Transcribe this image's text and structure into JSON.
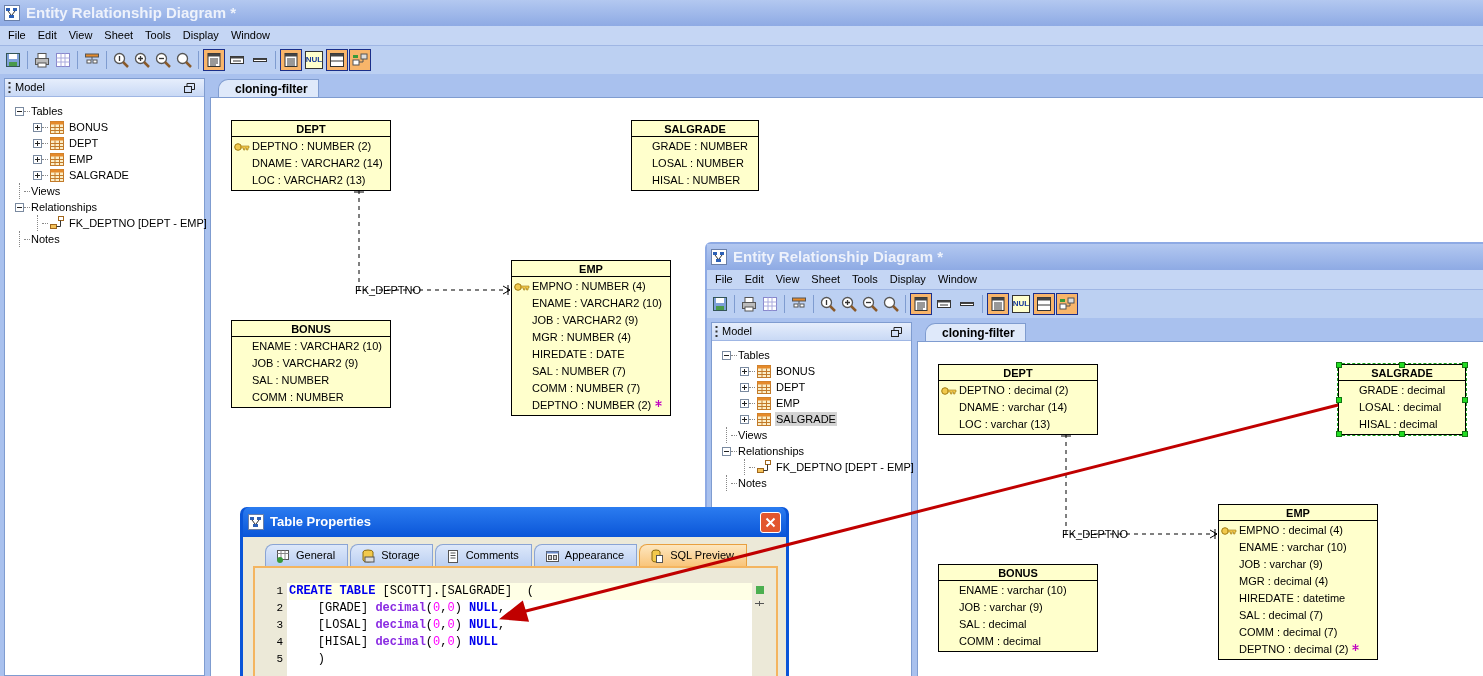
{
  "windows": [
    {
      "title": "Entity Relationship Diagram *",
      "menu": [
        "File",
        "Edit",
        "View",
        "Sheet",
        "Tools",
        "Display",
        "Window"
      ],
      "toolbar": {
        "view_toggles": [
          {
            "kind": "full",
            "selected": true
          },
          {
            "kind": "compact",
            "selected": false
          },
          {
            "kind": "title",
            "selected": false
          }
        ],
        "display_toggles": [
          {
            "kind": "columns",
            "selected": true
          },
          {
            "kind": "null",
            "label": "NUL",
            "selected": false
          },
          {
            "kind": "header",
            "selected": true
          },
          {
            "kind": "relation",
            "selected": true
          }
        ]
      },
      "model": {
        "title": "Model",
        "tree": [
          {
            "label": "Tables",
            "expanded": true,
            "children": [
              {
                "kind": "table",
                "label": "BONUS",
                "expanded": false,
                "selected": false
              },
              {
                "kind": "table",
                "label": "DEPT",
                "expanded": false,
                "selected": false
              },
              {
                "kind": "table",
                "label": "EMP",
                "expanded": false,
                "selected": false
              },
              {
                "kind": "table",
                "label": "SALGRADE",
                "expanded": false,
                "selected": false
              }
            ]
          },
          {
            "label": "Views"
          },
          {
            "label": "Relationships",
            "expanded": true,
            "children": [
              {
                "kind": "relationship",
                "label": "FK_DEPTNO [DEPT - EMP]",
                "selected": false
              }
            ]
          },
          {
            "label": "Notes"
          }
        ]
      },
      "tab": "cloning-filter",
      "diagram": {
        "entities": [
          {
            "name": "DEPT",
            "selected": false,
            "columns": [
              {
                "text": "DEPTNO : NUMBER (2)",
                "key": true,
                "fk": false
              },
              {
                "text": "DNAME : VARCHAR2 (14)",
                "key": false,
                "fk": false
              },
              {
                "text": "LOC : VARCHAR2 (13)",
                "key": false,
                "fk": false
              }
            ]
          },
          {
            "name": "SALGRADE",
            "selected": false,
            "columns": [
              {
                "text": "GRADE : NUMBER",
                "key": false,
                "fk": false
              },
              {
                "text": "LOSAL : NUMBER",
                "key": false,
                "fk": false
              },
              {
                "text": "HISAL : NUMBER",
                "key": false,
                "fk": false
              }
            ]
          },
          {
            "name": "EMP",
            "selected": false,
            "columns": [
              {
                "text": "EMPNO : NUMBER (4)",
                "key": true,
                "fk": false
              },
              {
                "text": "ENAME : VARCHAR2 (10)",
                "key": false,
                "fk": false
              },
              {
                "text": "JOB : VARCHAR2 (9)",
                "key": false,
                "fk": false
              },
              {
                "text": "MGR : NUMBER (4)",
                "key": false,
                "fk": false
              },
              {
                "text": "HIREDATE : DATE",
                "key": false,
                "fk": false
              },
              {
                "text": "SAL : NUMBER (7)",
                "key": false,
                "fk": false
              },
              {
                "text": "COMM : NUMBER (7)",
                "key": false,
                "fk": false
              },
              {
                "text": "DEPTNO : NUMBER (2)",
                "key": false,
                "fk": true
              }
            ]
          },
          {
            "name": "BONUS",
            "selected": false,
            "columns": [
              {
                "text": "ENAME : VARCHAR2 (10)",
                "key": false,
                "fk": false
              },
              {
                "text": "JOB : VARCHAR2 (9)",
                "key": false,
                "fk": false
              },
              {
                "text": "SAL : NUMBER",
                "key": false,
                "fk": false
              },
              {
                "text": "COMM : NUMBER",
                "key": false,
                "fk": false
              }
            ]
          }
        ],
        "relationships": [
          {
            "label": "FK_DEPTNO"
          }
        ]
      }
    },
    {
      "title": "Entity Relationship Diagram *",
      "menu": [
        "File",
        "Edit",
        "View",
        "Sheet",
        "Tools",
        "Display",
        "Window"
      ],
      "toolbar": {
        "view_toggles": [
          {
            "kind": "full",
            "selected": true
          },
          {
            "kind": "compact",
            "selected": false
          },
          {
            "kind": "title",
            "selected": false
          }
        ],
        "display_toggles": [
          {
            "kind": "columns",
            "selected": true
          },
          {
            "kind": "null",
            "label": "NUL",
            "selected": false
          },
          {
            "kind": "header",
            "selected": true
          },
          {
            "kind": "relation",
            "selected": true
          }
        ]
      },
      "model": {
        "title": "Model",
        "tree": [
          {
            "label": "Tables",
            "expanded": true,
            "children": [
              {
                "kind": "table",
                "label": "BONUS",
                "expanded": false,
                "selected": false
              },
              {
                "kind": "table",
                "label": "DEPT",
                "expanded": false,
                "selected": false
              },
              {
                "kind": "table",
                "label": "EMP",
                "expanded": false,
                "selected": false
              },
              {
                "kind": "table",
                "label": "SALGRADE",
                "expanded": false,
                "selected": true
              }
            ]
          },
          {
            "label": "Views"
          },
          {
            "label": "Relationships",
            "expanded": true,
            "children": [
              {
                "kind": "relationship",
                "label": "FK_DEPTNO [DEPT - EMP]",
                "selected": false
              }
            ]
          },
          {
            "label": "Notes"
          }
        ]
      },
      "tab": "cloning-filter",
      "diagram": {
        "entities": [
          {
            "name": "DEPT",
            "selected": false,
            "columns": [
              {
                "text": "DEPTNO : decimal (2)",
                "key": true,
                "fk": false
              },
              {
                "text": "DNAME : varchar (14)",
                "key": false,
                "fk": false
              },
              {
                "text": "LOC : varchar (13)",
                "key": false,
                "fk": false
              }
            ]
          },
          {
            "name": "SALGRADE",
            "selected": true,
            "columns": [
              {
                "text": "GRADE : decimal",
                "key": false,
                "fk": false
              },
              {
                "text": "LOSAL : decimal",
                "key": false,
                "fk": false
              },
              {
                "text": "HISAL : decimal",
                "key": false,
                "fk": false
              }
            ]
          },
          {
            "name": "EMP",
            "selected": false,
            "columns": [
              {
                "text": "EMPNO : decimal (4)",
                "key": true,
                "fk": false
              },
              {
                "text": "ENAME : varchar (10)",
                "key": false,
                "fk": false
              },
              {
                "text": "JOB : varchar (9)",
                "key": false,
                "fk": false
              },
              {
                "text": "MGR : decimal (4)",
                "key": false,
                "fk": false
              },
              {
                "text": "HIREDATE : datetime",
                "key": false,
                "fk": false
              },
              {
                "text": "SAL : decimal (7)",
                "key": false,
                "fk": false
              },
              {
                "text": "COMM : decimal (7)",
                "key": false,
                "fk": false
              },
              {
                "text": "DEPTNO : decimal (2)",
                "key": false,
                "fk": true
              }
            ]
          },
          {
            "name": "BONUS",
            "selected": false,
            "columns": [
              {
                "text": "ENAME : varchar (10)",
                "key": false,
                "fk": false
              },
              {
                "text": "JOB : varchar (9)",
                "key": false,
                "fk": false
              },
              {
                "text": "SAL : decimal",
                "key": false,
                "fk": false
              },
              {
                "text": "COMM : decimal",
                "key": false,
                "fk": false
              }
            ]
          }
        ],
        "relationships": [
          {
            "label": "FK_DEPTNO"
          }
        ]
      }
    }
  ],
  "dialog": {
    "title": "Table Properties",
    "tabs": [
      {
        "kind": "general",
        "label": "General",
        "selected": false
      },
      {
        "kind": "storage",
        "label": "Storage",
        "selected": false
      },
      {
        "kind": "comments",
        "label": "Comments",
        "selected": false
      },
      {
        "kind": "appearance",
        "label": "Appearance",
        "selected": false
      },
      {
        "kind": "sql",
        "label": "SQL Preview",
        "selected": true
      }
    ],
    "code": [
      {
        "number": "1",
        "current": true,
        "tokens": [
          {
            "kind": "keyword",
            "text": "CREATE TABLE"
          },
          {
            "kind": "plain",
            "text": " [SCOTT].[SALGRADE]  ("
          }
        ]
      },
      {
        "number": "2",
        "current": false,
        "tokens": [
          {
            "kind": "plain",
            "text": "    [GRADE] "
          },
          {
            "kind": "type",
            "text": "decimal"
          },
          {
            "kind": "plain",
            "text": "("
          },
          {
            "kind": "number",
            "text": "0"
          },
          {
            "kind": "plain",
            "text": ","
          },
          {
            "kind": "number",
            "text": "0"
          },
          {
            "kind": "plain",
            "text": ") "
          },
          {
            "kind": "keyword",
            "text": "NULL"
          },
          {
            "kind": "plain",
            "text": ","
          }
        ]
      },
      {
        "number": "3",
        "current": false,
        "tokens": [
          {
            "kind": "plain",
            "text": "    [LOSAL] "
          },
          {
            "kind": "type",
            "text": "decimal"
          },
          {
            "kind": "plain",
            "text": "("
          },
          {
            "kind": "number",
            "text": "0"
          },
          {
            "kind": "plain",
            "text": ","
          },
          {
            "kind": "number",
            "text": "0"
          },
          {
            "kind": "plain",
            "text": ") "
          },
          {
            "kind": "keyword",
            "text": "NULL"
          },
          {
            "kind": "plain",
            "text": ","
          }
        ]
      },
      {
        "number": "4",
        "current": false,
        "tokens": [
          {
            "kind": "plain",
            "text": "    [HISAL] "
          },
          {
            "kind": "type",
            "text": "decimal"
          },
          {
            "kind": "plain",
            "text": "("
          },
          {
            "kind": "number",
            "text": "0"
          },
          {
            "kind": "plain",
            "text": ","
          },
          {
            "kind": "number",
            "text": "0"
          },
          {
            "kind": "plain",
            "text": ") "
          },
          {
            "kind": "keyword",
            "text": "NULL"
          }
        ]
      },
      {
        "number": "5",
        "current": false,
        "tokens": [
          {
            "kind": "plain",
            "text": "    )"
          }
        ]
      }
    ]
  }
}
